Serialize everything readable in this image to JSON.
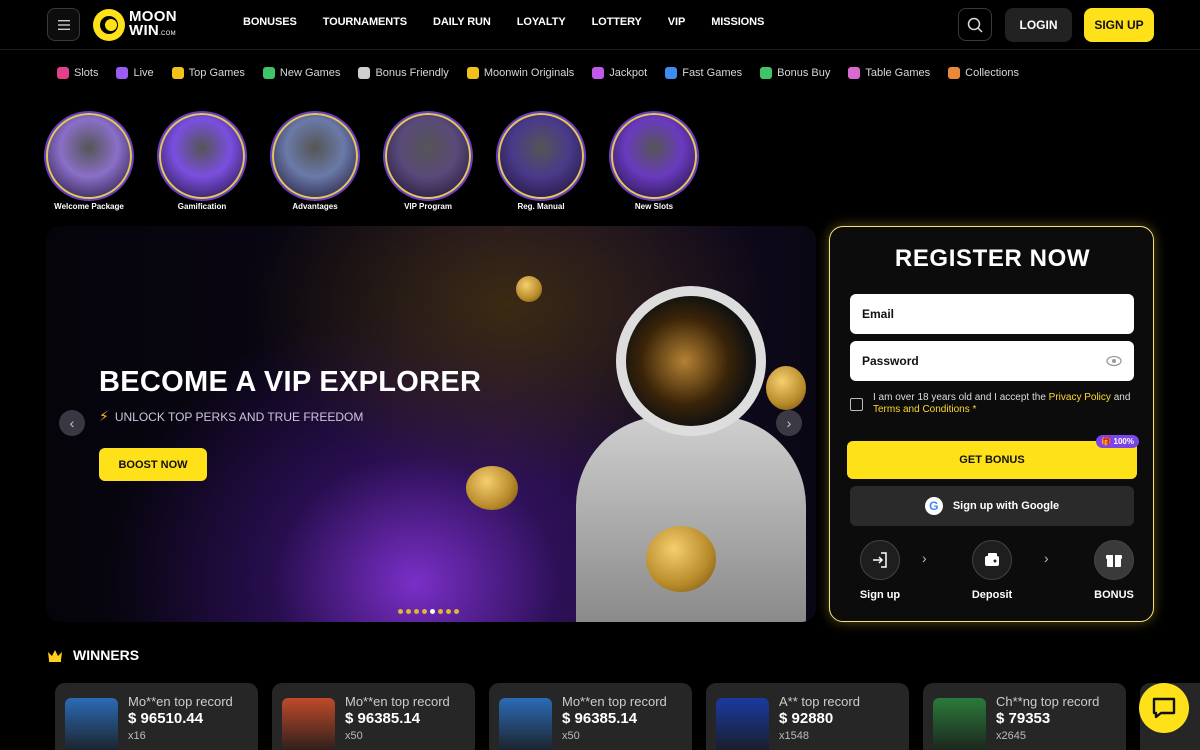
{
  "header": {
    "logo_line1": "MOON",
    "logo_line2": "WIN",
    "logo_suffix": ".COM",
    "nav": [
      "BONUSES",
      "TOURNAMENTS",
      "DAILY RUN",
      "LOYALTY",
      "LOTTERY",
      "VIP",
      "MISSIONS"
    ],
    "login_label": "LOGIN",
    "signup_label": "SIGN UP"
  },
  "categories": [
    {
      "label": "Slots",
      "color": "#e2408a"
    },
    {
      "label": "Live",
      "color": "#9b5cf0"
    },
    {
      "label": "Top Games",
      "color": "#f2c21a"
    },
    {
      "label": "New Games",
      "color": "#3fc46a"
    },
    {
      "label": "Bonus Friendly",
      "color": "#cfcfcf"
    },
    {
      "label": "Moonwin Originals",
      "color": "#f2c21a"
    },
    {
      "label": "Jackpot",
      "color": "#c05ae8"
    },
    {
      "label": "Fast Games",
      "color": "#3f8cf0"
    },
    {
      "label": "Bonus Buy",
      "color": "#3fc46a"
    },
    {
      "label": "Table Games",
      "color": "#d86ad0"
    },
    {
      "label": "Collections",
      "color": "#e88a3a"
    }
  ],
  "stories": [
    {
      "label": "Welcome Package",
      "bg": "#8a6fc8"
    },
    {
      "label": "Gamification",
      "bg": "#7a4fe0"
    },
    {
      "label": "Advantages",
      "bg": "#6a7aa8"
    },
    {
      "label": "VIP Program",
      "bg": "#5a4a7a"
    },
    {
      "label": "Reg. Manual",
      "bg": "#4a3a8a"
    },
    {
      "label": "New Slots",
      "bg": "#6a3ac0"
    }
  ],
  "hero": {
    "title": "BECOME A VIP EXPLORER",
    "subtitle": "UNLOCK TOP PERKS AND TRUE FREEDOM",
    "cta": "BOOST NOW",
    "slide_count": 8,
    "active_slide": 4
  },
  "register": {
    "title": "REGISTER NOW",
    "email_placeholder": "Email",
    "password_placeholder": "Password",
    "terms_prefix": "I am over 18 years old and I accept the",
    "privacy_link": "Privacy Policy",
    "terms_and": "and",
    "terms_link": "Terms and Conditions",
    "terms_required": "*",
    "bonus_button": "GET BONUS",
    "bonus_badge": "100%",
    "google_button": "Sign up with Google",
    "steps": [
      "Sign up",
      "Deposit",
      "BONUS"
    ]
  },
  "winners": {
    "title": "WINNERS",
    "cards": [
      {
        "title": "Mo**en top record",
        "amount": "$ 96510.44",
        "mult": "x16",
        "thumb": "#2b6bb5"
      },
      {
        "title": "Mo**en top record",
        "amount": "$ 96385.14",
        "mult": "x50",
        "thumb": "#c04a2a"
      },
      {
        "title": "Mo**en top record",
        "amount": "$ 96385.14",
        "mult": "x50",
        "thumb": "#2b6bb5"
      },
      {
        "title": "A** top record",
        "amount": "$ 92880",
        "mult": "x1548",
        "thumb": "#1a3aa0"
      },
      {
        "title": "Ch**ng top record",
        "amount": "$ 79353",
        "mult": "x2645",
        "thumb": "#2a7a3a"
      }
    ]
  }
}
